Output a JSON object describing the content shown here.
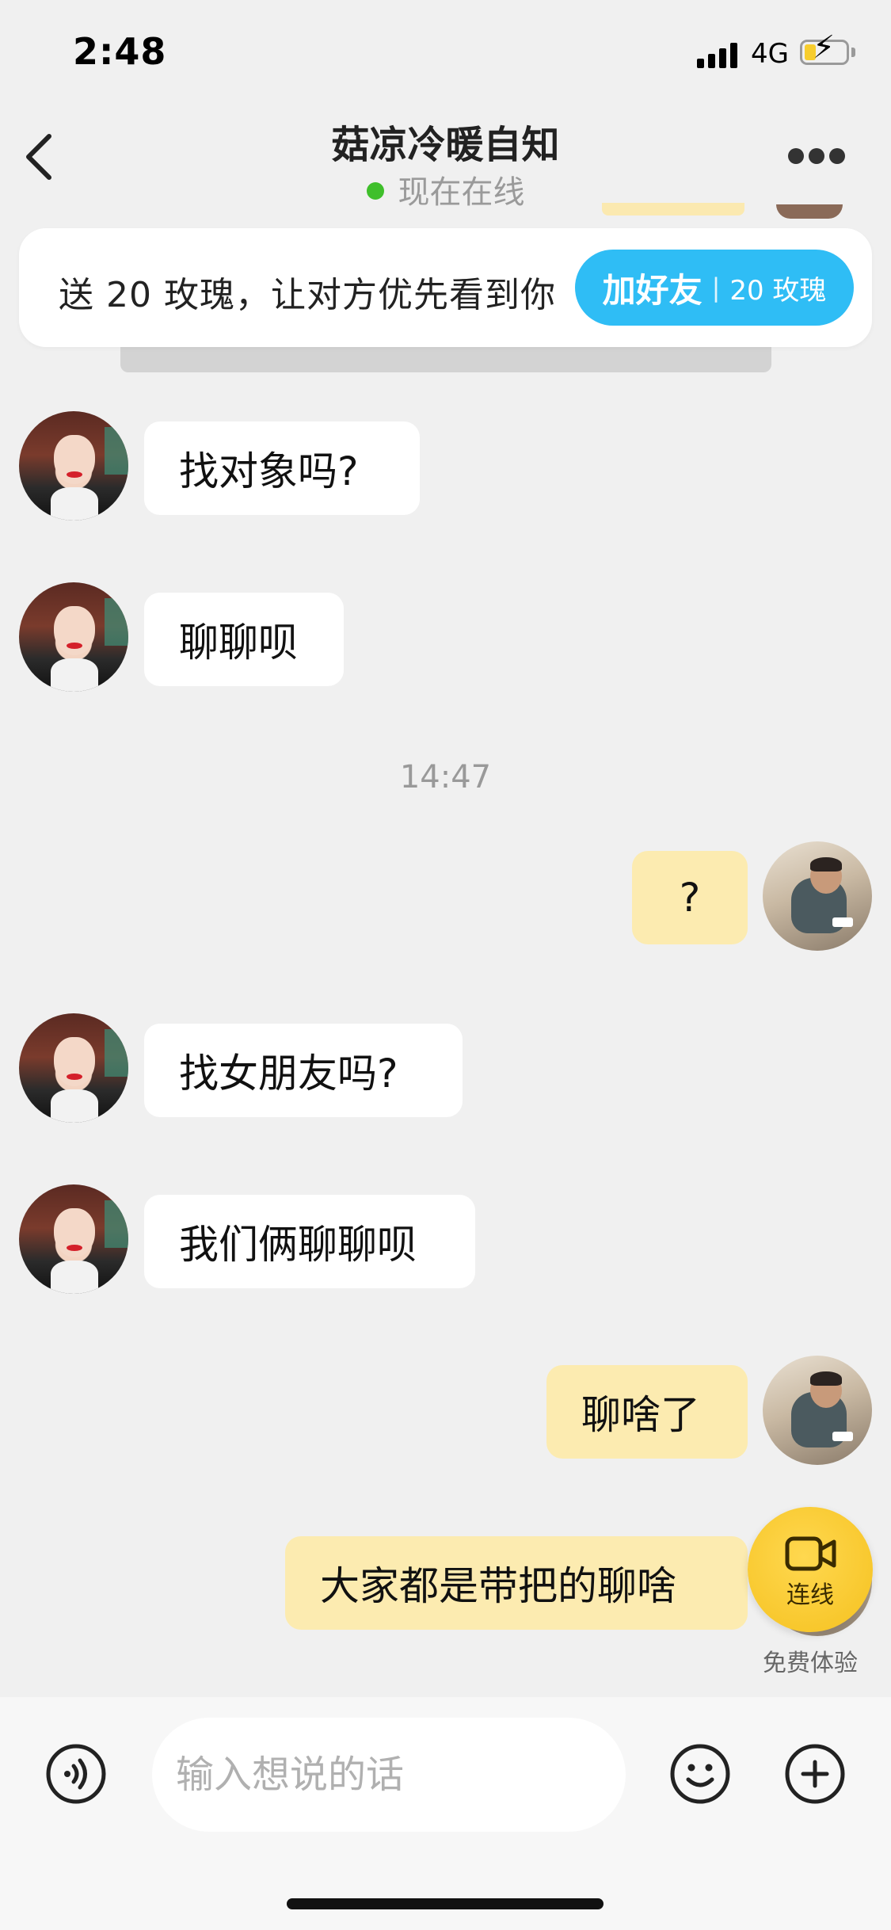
{
  "status_bar": {
    "time": "2:48",
    "network": "4G"
  },
  "header": {
    "title": "菇凉冷暖自知",
    "status": "现在在线"
  },
  "banner": {
    "text": "送 20 玫瑰，让对方优先看到你",
    "button_label": "加好友",
    "button_separator": "|",
    "button_cost": "20 玫瑰"
  },
  "messages": [
    {
      "side": "left",
      "text": "找对象吗?"
    },
    {
      "side": "left",
      "text": "聊聊呗"
    },
    {
      "divider": "14:47"
    },
    {
      "side": "right",
      "text": "?"
    },
    {
      "side": "left",
      "text": "找女朋友吗?"
    },
    {
      "side": "left",
      "text": "我们俩聊聊呗"
    },
    {
      "side": "right",
      "text": "聊啥了"
    },
    {
      "side": "right",
      "text": "大家都是带把的聊啥"
    }
  ],
  "video_call": {
    "label": "连线",
    "caption": "免费体验"
  },
  "input": {
    "placeholder": "输入想说的话"
  },
  "icons": {
    "back": "chevron-left-icon",
    "more": "more-dots-icon",
    "voice": "voice-icon",
    "emoji": "emoji-icon",
    "plus": "plus-icon",
    "video": "video-camera-icon"
  },
  "colors": {
    "accent_blue": "#2fbdf5",
    "outgoing_bubble": "#fcebb0",
    "online_dot": "#3fbf2b",
    "video_button": "#f5c11f"
  }
}
